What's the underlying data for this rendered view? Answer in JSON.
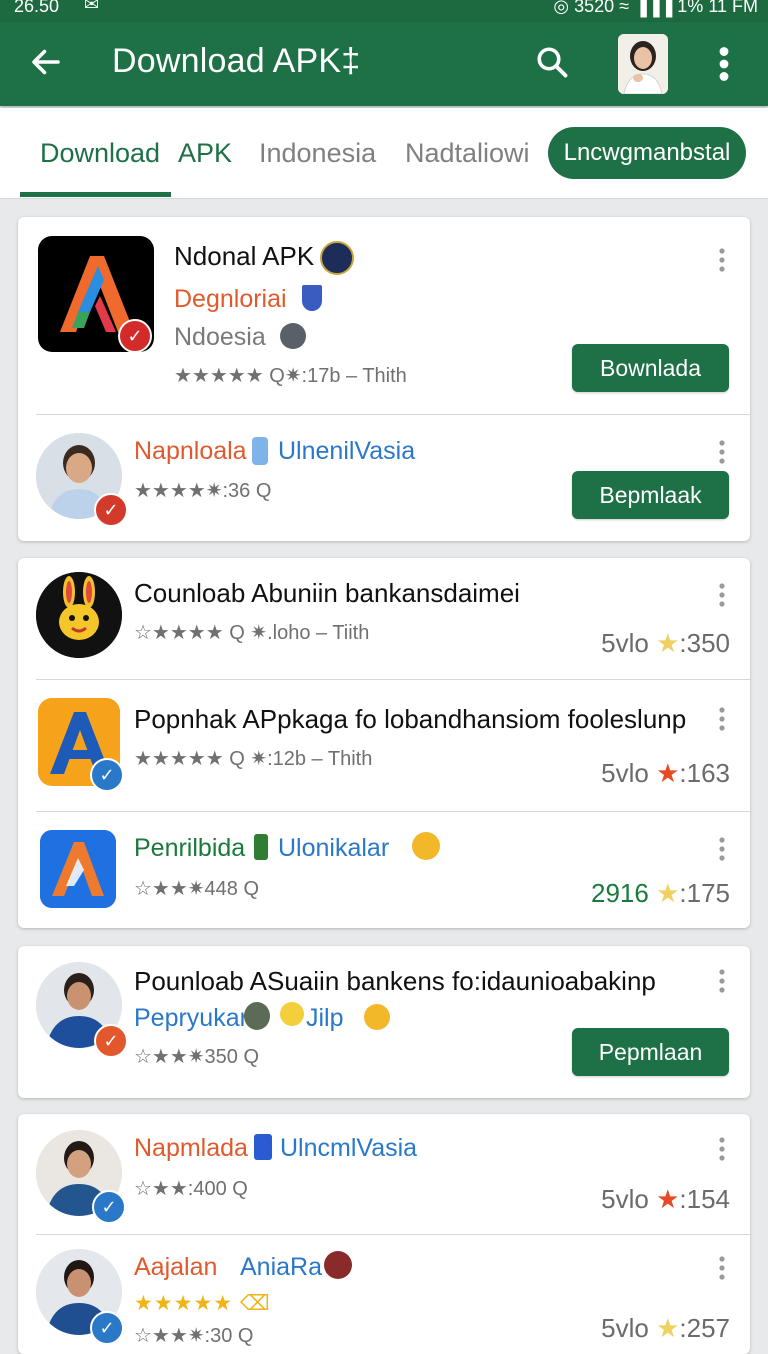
{
  "status_bar": {
    "time": "26.50",
    "right_text": "◎ 3520 ≈  ▐▐▐  1%  11 FM"
  },
  "app_bar": {
    "title": "Download APK‡"
  },
  "tabs": [
    {
      "label": "Download"
    },
    {
      "label": "APK"
    },
    {
      "label": "Indonesia"
    },
    {
      "label": "Nadtaliowi"
    },
    {
      "label": "Lncwgmanbstal"
    }
  ],
  "cards": [
    {
      "rows": [
        {
          "title": "Ndonal APK",
          "subtitle": "Degnloriai",
          "extra": "Ndoesia",
          "meta": "★★★★★  Q✷:17b – Thith",
          "button": "Bownlada"
        },
        {
          "title": "Napnloala",
          "title2": "UlnenilVasia",
          "meta": "★★★★✷:36   Q",
          "button": "Bepmlaak"
        }
      ]
    },
    {
      "rows": [
        {
          "title": "Counloab Abuniin bankansdaimei",
          "meta": "☆★★★★   Q ✷.loho – Tiith",
          "rating_prefix": "5vlo",
          "rating_value": ":350"
        },
        {
          "title": "Popnhak APpkaga fo lobandhansiom fooleslunp",
          "meta": "★★★★★   Q ✷:12b – Thith",
          "rating_prefix": "5vlo",
          "rating_value": ":163"
        },
        {
          "title": "Penrilbida",
          "title2": "Ulonikalar",
          "meta": "☆★★✷448   Q",
          "rating_prefix": "2916",
          "rating_value": ":175"
        }
      ]
    },
    {
      "rows": [
        {
          "title": "Pounloab ASuaiin bankens fo:idaunioabakinp",
          "subtitle": "Pepryukar",
          "subtitle2": "Jilp",
          "meta": "☆★★✷350   Q",
          "button": "Pepmlaan"
        }
      ]
    },
    {
      "rows": [
        {
          "title": "Napmlada",
          "title2": "UlncmlVasia",
          "meta": "☆★★:400   Q",
          "rating_prefix": "5vlo",
          "rating_value": ":154"
        },
        {
          "title": "Aajalan",
          "title2": "AniaRa",
          "meta": "★★★★★   ⌫",
          "meta2": "☆★★✷:30   Q",
          "rating_prefix": "5vlo",
          "rating_value": ":257"
        }
      ]
    }
  ],
  "colors": {
    "primary": "#1e7046",
    "accent_orange": "#e05a2b",
    "accent_blue": "#2a78c8",
    "star_yellow": "#f0c419",
    "star_green": "#2e9b55"
  }
}
